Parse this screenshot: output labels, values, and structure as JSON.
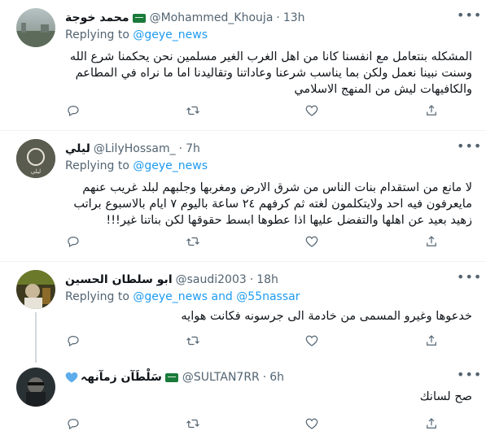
{
  "tweets": [
    {
      "name": "محمد خوجة",
      "handle": "@Mohammed_Khouja",
      "time": "13h",
      "replying_prefix": "Replying to",
      "replying_to": "@geye_news",
      "replying_and": "",
      "replying_to2": "",
      "text": "المشكله بنتعامل مع انفسنا كانا من اهل الغرب الغير مسلمين نحن يحكمنا شرع الله وسنت نبينا نعمل ولكن بما يناسب شرعنا وعاداتنا وتقاليدنا اما ما نراه في المطاعم والكافيهات ليش من المنهج الاسلامي",
      "has_flag": true
    },
    {
      "name": "ليلي",
      "handle": "@LilyHossam_",
      "time": "7h",
      "replying_prefix": "Replying to",
      "replying_to": "@geye_news",
      "replying_and": "",
      "replying_to2": "",
      "text": "لا مانع من استقدام بنات الناس من شرق الارض ومغربها وجلبهم لبلد غريب عنهم مايعرفون فيه احد ولايتكلمون لغته ثم كرفهم ٢٤ ساعة باليوم ٧ ايام بالاسبوع براتب زهيد بعيد عن اهلها والتفضل عليها اذا عطوها ابسط حقوقها لكن بناتنا غير!!!",
      "has_flag": false,
      "avatar_text": "ليلي"
    },
    {
      "name": "ابو سلطان الحسين",
      "handle": "@saudi2003",
      "time": "18h",
      "replying_prefix": "Replying to",
      "replying_to": "@geye_news",
      "replying_and": "and",
      "replying_to2": "@55nassar",
      "text": "خدعوها وغيرو المسمى من خادمة الى جرسونه فكانت هوايه",
      "has_flag": false
    },
    {
      "name": "سَلْطَآن زمآنهہ",
      "handle": "@SULTAN7RR",
      "time": "6h",
      "text": "صح لسانك",
      "has_flag": true
    }
  ],
  "separator": "·",
  "icons": [
    "more-icon",
    "reply-icon",
    "retweet-icon",
    "like-icon",
    "share-icon",
    "heart-emoji-icon"
  ],
  "colors": {
    "link": "#1d9bf0",
    "muted": "#536471",
    "text": "#0f1419",
    "flag": "#1a7a3a"
  }
}
